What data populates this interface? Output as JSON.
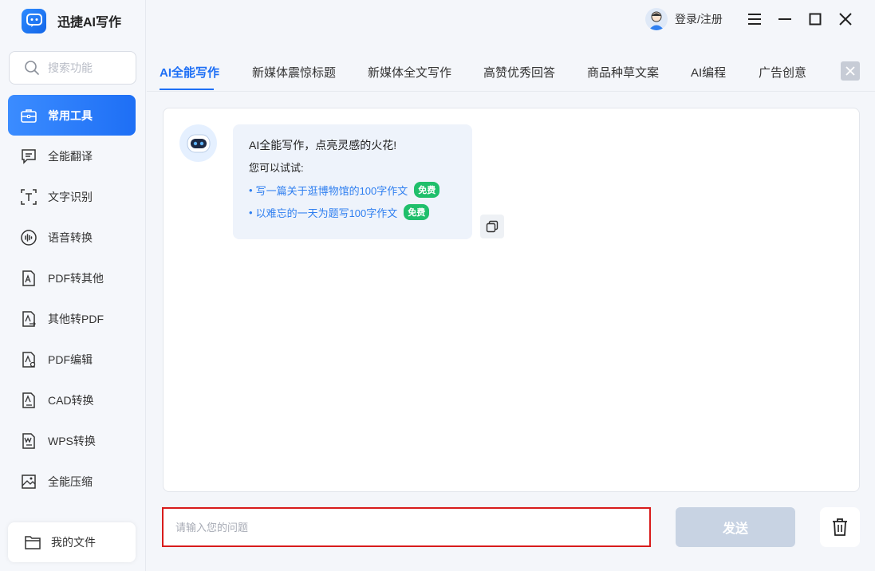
{
  "app": {
    "name": "迅捷AI写作"
  },
  "search": {
    "placeholder": "搜索功能"
  },
  "sidebar": {
    "items": [
      {
        "label": "常用工具",
        "icon": "toolbox-icon",
        "active": true
      },
      {
        "label": "全能翻译",
        "icon": "translate-icon"
      },
      {
        "label": "文字识别",
        "icon": "text-recognition-icon"
      },
      {
        "label": "语音转换",
        "icon": "voice-convert-icon"
      },
      {
        "label": "PDF转其他",
        "icon": "pdf-convert-icon"
      },
      {
        "label": "其他转PDF",
        "icon": "to-pdf-icon"
      },
      {
        "label": "PDF编辑",
        "icon": "pdf-edit-icon"
      },
      {
        "label": "CAD转换",
        "icon": "cad-convert-icon"
      },
      {
        "label": "WPS转换",
        "icon": "wps-convert-icon"
      },
      {
        "label": "全能压缩",
        "icon": "compress-icon"
      }
    ],
    "my_files": "我的文件"
  },
  "header": {
    "login_label": "登录/注册"
  },
  "tabs": [
    {
      "label": "AI全能写作",
      "active": true
    },
    {
      "label": "新媒体震惊标题"
    },
    {
      "label": "新媒体全文写作"
    },
    {
      "label": "高赞优秀回答"
    },
    {
      "label": "商品种草文案"
    },
    {
      "label": "AI编程"
    },
    {
      "label": "广告创意"
    }
  ],
  "chat": {
    "greeting": "AI全能写作，点亮灵感的火花!",
    "hint": "您可以试试:",
    "suggestions": [
      {
        "text": "写一篇关于逛博物馆的100字作文",
        "badge": "免费"
      },
      {
        "text": "以难忘的一天为题写100字作文",
        "badge": "免费"
      }
    ]
  },
  "composer": {
    "placeholder": "请输入您的问题",
    "send_label": "发送"
  },
  "colors": {
    "accent": "#1e6ff5",
    "badge_green": "#1fbf6b",
    "input_border": "#d81b1b",
    "send_disabled": "#c8d3e3"
  }
}
